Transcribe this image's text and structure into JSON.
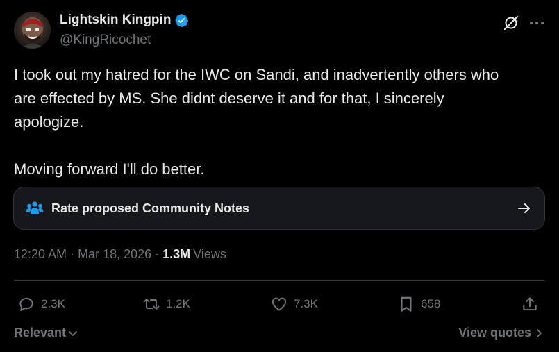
{
  "author": {
    "display_name": "Lightskin Kingpin",
    "handle": "@KingRicochet",
    "verified": true,
    "verified_color": "#1d9bf0"
  },
  "header_icons": [
    "grok-icon",
    "more-icon"
  ],
  "tweet": {
    "lines": [
      "I took out my hatred for the IWC on Sandi, and inadvertently others who",
      "are effected by MS. She didnt deserve it and for that, I sincerely",
      "apologize.",
      "Moving forward I'll do better."
    ]
  },
  "community_notes": {
    "label": "Rate proposed Community Notes",
    "icon": "people-icon",
    "icon_color": "#1d9bf0"
  },
  "meta": {
    "time": "12:20 AM",
    "separator": "·",
    "date": "Mar 18, 2026",
    "views_count": "1.3M",
    "views_label": "Views"
  },
  "actions": {
    "replies": "2.3K",
    "reposts": "1.2K",
    "likes": "7.3K",
    "bookmarks": "658"
  },
  "footer": {
    "sort_label": "Relevant",
    "view_quotes_label": "View quotes"
  },
  "colors": {
    "background": "#000000",
    "text_primary": "#e7e9ea",
    "text_secondary": "#71767b",
    "border": "#2f3336",
    "card_bg": "#16181c",
    "accent": "#1d9bf0"
  }
}
